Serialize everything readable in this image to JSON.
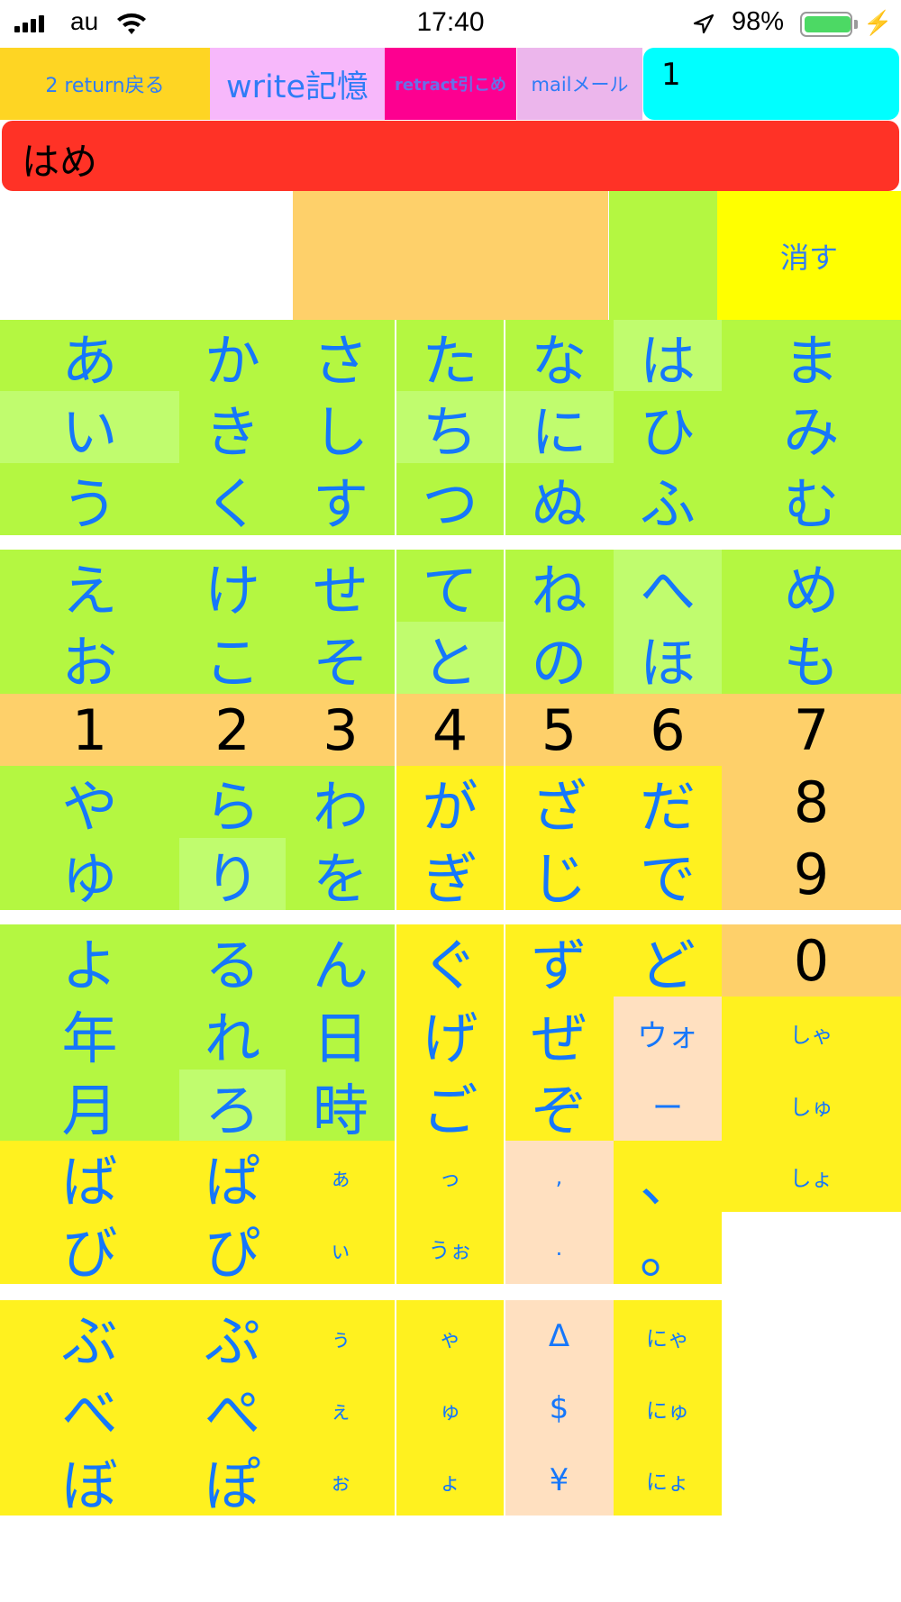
{
  "status_bar": {
    "carrier": "au",
    "time": "17:40",
    "battery_percent": "98%",
    "battery_level": 0.98,
    "icons": [
      "signal-icon",
      "wifi-icon",
      "location-arrow-icon",
      "battery-icon",
      "charging-bolt-icon"
    ]
  },
  "header": {
    "return_label": "2 return戻る",
    "write_label": "write記憶",
    "retract_label": "retract引こめ",
    "mail_label": "mailメール",
    "count_value": "1",
    "composed_text": "はめ",
    "erase_label": "消す"
  },
  "colors": {
    "green": "#b4f741",
    "highlight_green": "#c0fc6e",
    "yellow": "#fff11f",
    "orange": "#fed06a",
    "peach": "#ffe0c0",
    "key_text": "#1577fb",
    "text_bar": "#ff3226",
    "count_field": "#00ffff"
  },
  "keys": [
    {
      "k": "あ"
    },
    {
      "k": "か"
    },
    {
      "k": "さ"
    },
    {
      "k": "た"
    },
    {
      "k": "な"
    },
    {
      "k": "は"
    },
    {
      "k": "ま"
    },
    {
      "k": "い"
    },
    {
      "k": "き"
    },
    {
      "k": "し"
    },
    {
      "k": "ち"
    },
    {
      "k": "に"
    },
    {
      "k": "ひ"
    },
    {
      "k": "み"
    },
    {
      "k": "う"
    },
    {
      "k": "く"
    },
    {
      "k": "す"
    },
    {
      "k": "つ"
    },
    {
      "k": "ぬ"
    },
    {
      "k": "ふ"
    },
    {
      "k": "む"
    },
    {
      "k": "え"
    },
    {
      "k": "け"
    },
    {
      "k": "せ"
    },
    {
      "k": "て"
    },
    {
      "k": "ね"
    },
    {
      "k": "へ"
    },
    {
      "k": "め"
    },
    {
      "k": "お"
    },
    {
      "k": "こ"
    },
    {
      "k": "そ"
    },
    {
      "k": "と"
    },
    {
      "k": "の"
    },
    {
      "k": "ほ"
    },
    {
      "k": "も"
    },
    {
      "k": "1"
    },
    {
      "k": "2"
    },
    {
      "k": "3"
    },
    {
      "k": "4"
    },
    {
      "k": "5"
    },
    {
      "k": "6"
    },
    {
      "k": "7"
    },
    {
      "k": "や"
    },
    {
      "k": "ら"
    },
    {
      "k": "わ"
    },
    {
      "k": "が"
    },
    {
      "k": "ざ"
    },
    {
      "k": "だ"
    },
    {
      "k": "8"
    },
    {
      "k": "ゆ"
    },
    {
      "k": "り"
    },
    {
      "k": "を"
    },
    {
      "k": "ぎ"
    },
    {
      "k": "じ"
    },
    {
      "k": "で"
    },
    {
      "k": "9"
    },
    {
      "k": "よ"
    },
    {
      "k": "る"
    },
    {
      "k": "ん"
    },
    {
      "k": "ぐ"
    },
    {
      "k": "ず"
    },
    {
      "k": "ど"
    },
    {
      "k": "0"
    },
    {
      "k": "年"
    },
    {
      "k": "れ"
    },
    {
      "k": "日"
    },
    {
      "k": "げ"
    },
    {
      "k": "ぜ"
    },
    {
      "k": "ウォ"
    },
    {
      "k": "しゃ"
    },
    {
      "k": "月"
    },
    {
      "k": "ろ"
    },
    {
      "k": "時"
    },
    {
      "k": "ご"
    },
    {
      "k": "ぞ"
    },
    {
      "k": "ー"
    },
    {
      "k": "しゅ"
    },
    {
      "k": "ば"
    },
    {
      "k": "ぱ"
    },
    {
      "k": "ぁ"
    },
    {
      "k": "っ"
    },
    {
      "k": ","
    },
    {
      "k": "、"
    },
    {
      "k": "しょ"
    },
    {
      "k": "び"
    },
    {
      "k": "ぴ"
    },
    {
      "k": "ぃ"
    },
    {
      "k": "うぉ"
    },
    {
      "k": "."
    },
    {
      "k": "。"
    },
    {
      "k": "ぶ"
    },
    {
      "k": "ぷ"
    },
    {
      "k": "ぅ"
    },
    {
      "k": "ゃ"
    },
    {
      "k": "Δ"
    },
    {
      "k": "にゃ"
    },
    {
      "k": "べ"
    },
    {
      "k": "ぺ"
    },
    {
      "k": "ぇ"
    },
    {
      "k": "ゅ"
    },
    {
      "k": "$"
    },
    {
      "k": "にゅ"
    },
    {
      "k": "ぼ"
    },
    {
      "k": "ぽ"
    },
    {
      "k": "ぉ"
    },
    {
      "k": "ょ"
    },
    {
      "k": "¥"
    },
    {
      "k": "にょ"
    }
  ]
}
